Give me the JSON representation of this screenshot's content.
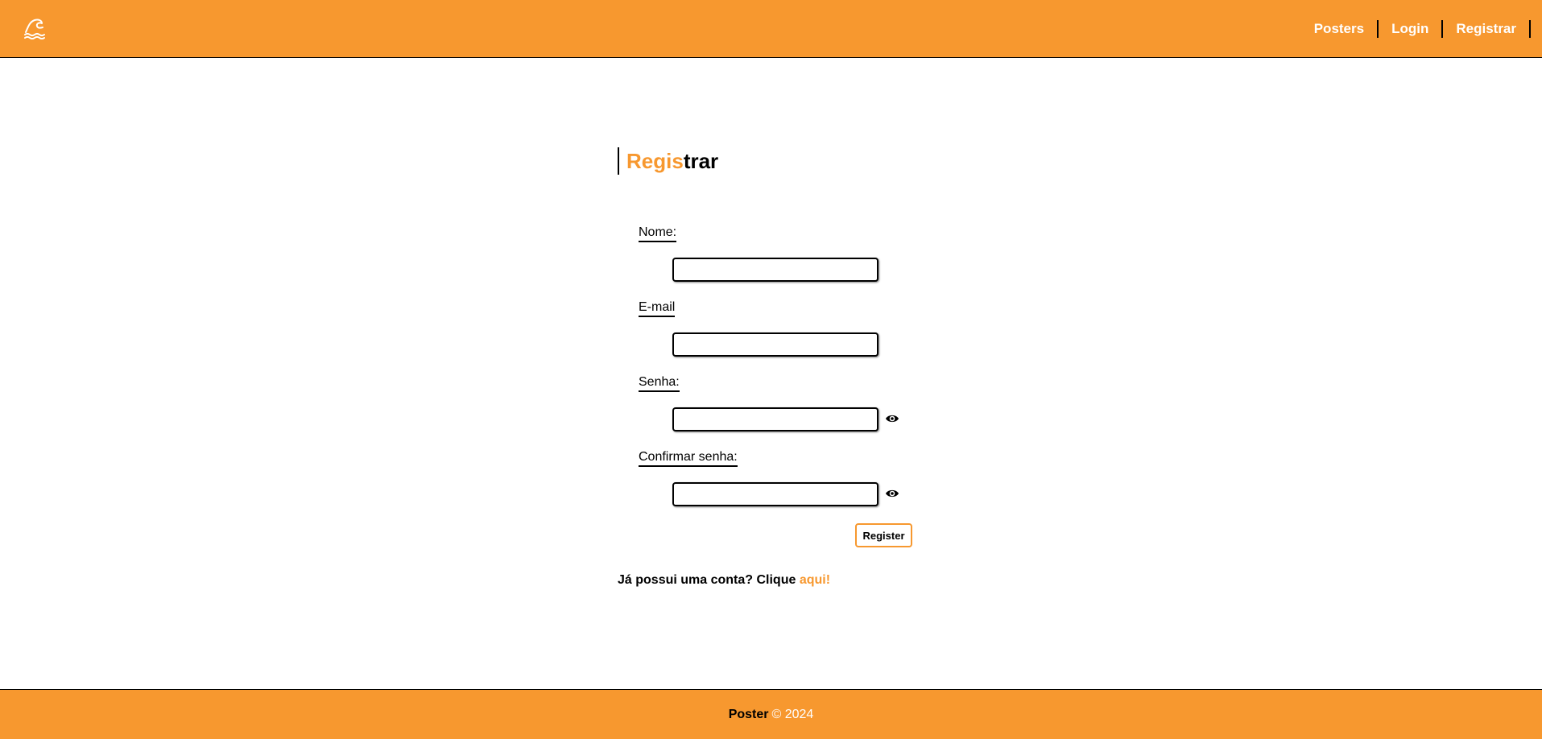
{
  "header": {
    "logo_icon": "wave-icon",
    "nav": [
      {
        "label": "Posters"
      },
      {
        "label": "Login"
      },
      {
        "label": "Registrar"
      }
    ]
  },
  "title": {
    "accent": "Regis",
    "rest": "trar"
  },
  "form": {
    "name_label": "Nome:",
    "name_value": "",
    "email_label": "E-mail",
    "email_value": "",
    "password_label": "Senha:",
    "password_value": "",
    "confirm_label": "Confirmar senha:",
    "confirm_value": "",
    "toggle_icon": "eye-icon",
    "submit_label": "Register"
  },
  "account": {
    "prompt": "Já possui uma conta? Clique ",
    "link": "aqui!"
  },
  "footer": {
    "brand": "Poster",
    "copyright": "© 2024"
  },
  "colors": {
    "accent": "#f7982f",
    "text": "#000000",
    "on_accent": "#ffffff"
  }
}
